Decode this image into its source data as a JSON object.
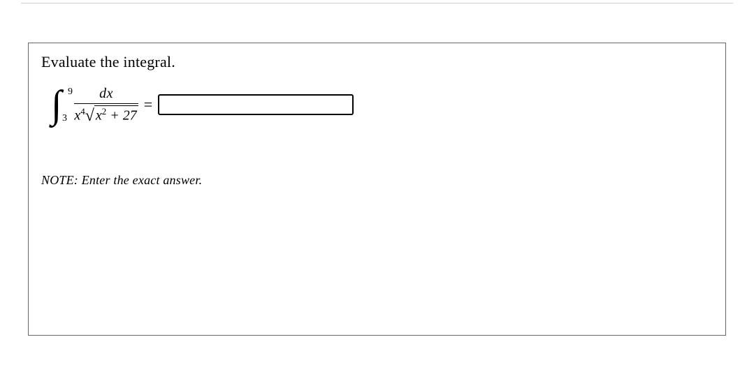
{
  "problem": {
    "prompt": "Evaluate the integral.",
    "integral": {
      "upper_limit": "9",
      "lower_limit": "3",
      "numerator": "dx",
      "denom_leading": "x",
      "denom_leading_exp": "4",
      "radicand_var": "x",
      "radicand_exp": "2",
      "radicand_plus_const": " + 27"
    },
    "equals": "=",
    "answer_value": ""
  },
  "note": "NOTE: Enter the exact answer."
}
